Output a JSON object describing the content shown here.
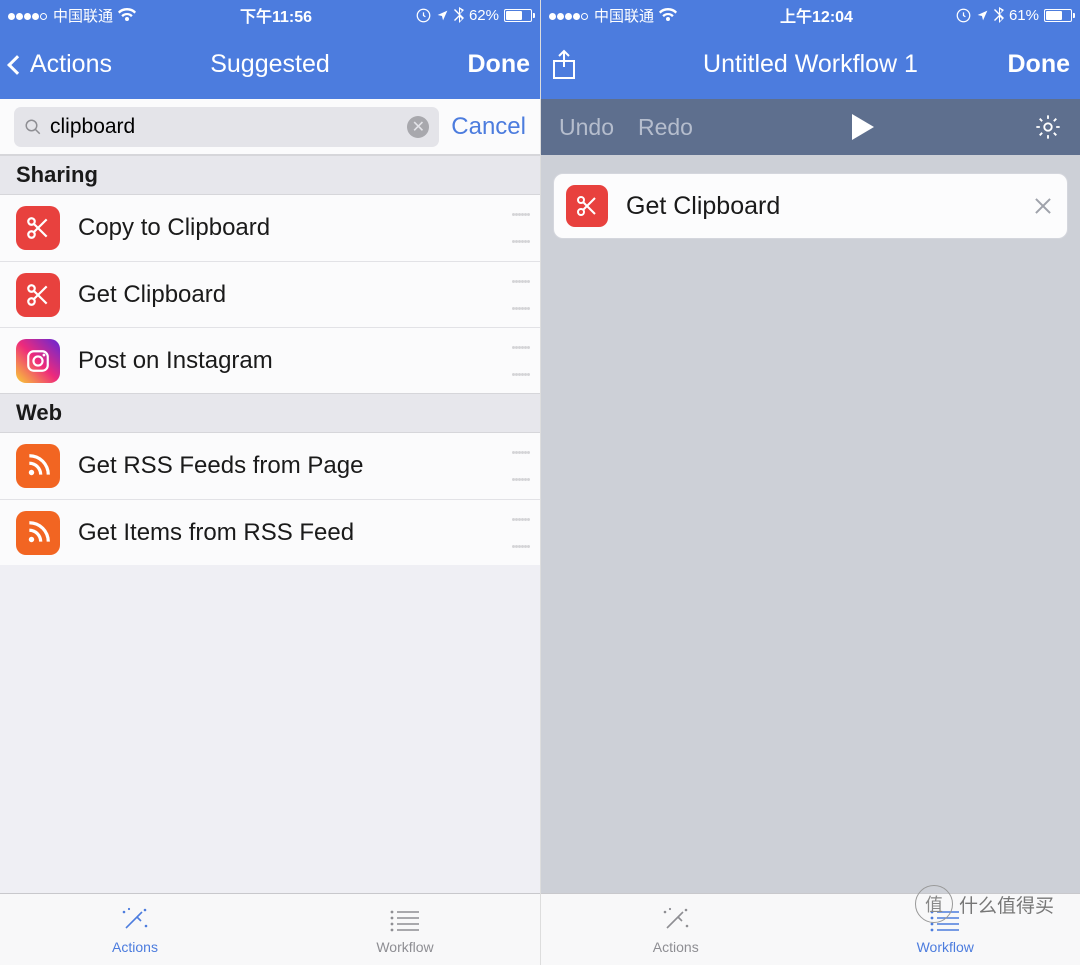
{
  "screens": {
    "left": {
      "statusbar": {
        "signal_dots_filled": 4,
        "carrier": "中国联通",
        "time": "下午11:56",
        "battery_text": "62%",
        "battery_level": 0.62
      },
      "navbar": {
        "back": "Actions",
        "title": "Suggested",
        "done": "Done"
      },
      "search": {
        "value": "clipboard",
        "cancel": "Cancel"
      },
      "sections": [
        {
          "header": "Sharing",
          "items": [
            {
              "icon": "scissors",
              "label": "Copy to Clipboard",
              "bg": "#e8413e"
            },
            {
              "icon": "scissors",
              "label": "Get Clipboard",
              "bg": "#e8413e"
            },
            {
              "icon": "instagram",
              "label": "Post on Instagram"
            }
          ]
        },
        {
          "header": "Web",
          "items": [
            {
              "icon": "rss",
              "label": "Get RSS Feeds from Page",
              "bg": "#f26522"
            },
            {
              "icon": "rss",
              "label": "Get Items from RSS Feed",
              "bg": "#f26522"
            }
          ]
        }
      ],
      "tabs": {
        "actions": "Actions",
        "workflow": "Workflow",
        "active": "actions"
      }
    },
    "right": {
      "statusbar": {
        "signal_dots_filled": 4,
        "carrier": "中国联通",
        "time": "上午12:04",
        "battery_text": "61%",
        "battery_level": 0.61
      },
      "navbar": {
        "title": "Untitled Workflow 1",
        "done": "Done"
      },
      "toolbar": {
        "undo": "Undo",
        "redo": "Redo"
      },
      "steps": [
        {
          "icon": "scissors",
          "label": "Get Clipboard",
          "bg": "#e8413e"
        }
      ],
      "tabs": {
        "actions": "Actions",
        "workflow": "Workflow",
        "active": "workflow"
      }
    }
  },
  "watermark": "什么值得买"
}
